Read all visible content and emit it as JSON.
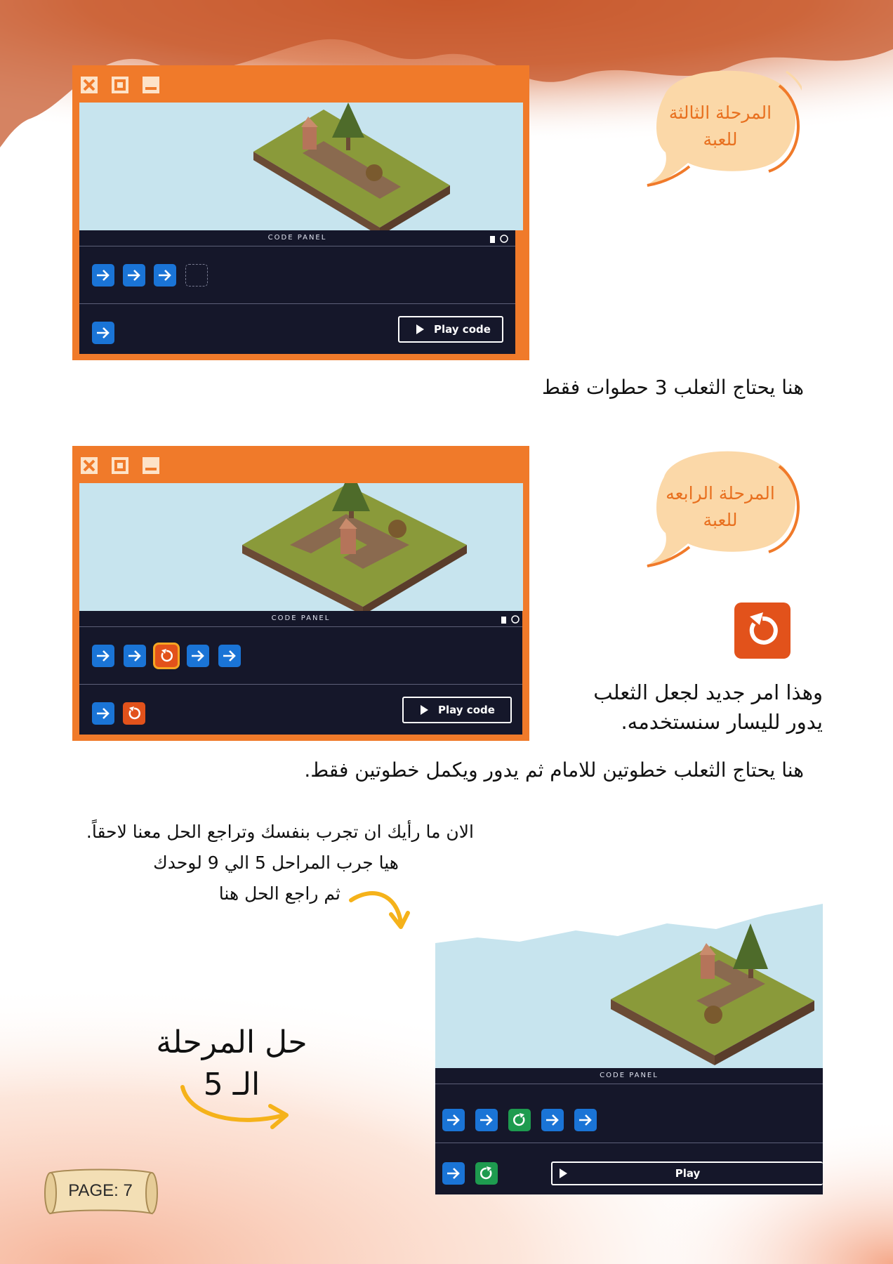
{
  "colors": {
    "orange": "#f07a2a",
    "sky": "#c7e4ee",
    "panel": "#15172a",
    "blue": "#1a74d6",
    "turn": "#e2521b",
    "green": "#1e9b4f",
    "bubble": "#fbd8a8",
    "arrowYellow": "#f5b21a"
  },
  "section1": {
    "window_icons": [
      "close-icon",
      "maximize-icon",
      "minimize-icon"
    ],
    "code_panel_title": "CODE PANEL",
    "code_blocks": [
      "arrow-right",
      "arrow-right",
      "arrow-right",
      "empty-slot"
    ],
    "toolbox_blocks": [
      "arrow-right"
    ],
    "play_label": "Play code",
    "bubble_line1": "المرحلة الثالثة",
    "bubble_line2": "للعبة",
    "caption": "هنا يحتاج الثعلب 3 حطوات فقط"
  },
  "section2": {
    "window_icons": [
      "close-icon",
      "maximize-icon",
      "minimize-icon"
    ],
    "code_panel_title": "CODE PANEL",
    "code_blocks": [
      "arrow-right",
      "arrow-right",
      "turn-left",
      "arrow-right",
      "arrow-right"
    ],
    "toolbox_blocks": [
      "arrow-right",
      "turn-left"
    ],
    "play_label": "Play code",
    "bubble_line1": "المرحلة الرابعه",
    "bubble_line2": "للعبة",
    "new_command_line1": "وهذا امر جديد لجعل الثعلب",
    "new_command_line2": "يدور لليسار سنستخدمه.",
    "caption": "هنا يحتاج الثعلب خطوتين للامام ثم يدور ويكمل خطوتين فقط."
  },
  "section3": {
    "line1": "الان ما رأيك ان تجرب بنفسك وتراجع الحل معنا لاحقاً.",
    "line2": "هيا جرب المراحل 5 الي 9 لوحدك",
    "line3": "ثم راجع الحل هنا",
    "solution_line1": "حل المرحلة",
    "solution_line2": "الـ 5",
    "code_panel_title": "CODE PANEL",
    "code_blocks": [
      "arrow-right",
      "arrow-right",
      "turn-right",
      "arrow-right",
      "arrow-right"
    ],
    "toolbox_blocks": [
      "arrow-right",
      "turn-right"
    ],
    "play_label": "Play"
  },
  "footer": {
    "page_label": "PAGE: 7"
  }
}
